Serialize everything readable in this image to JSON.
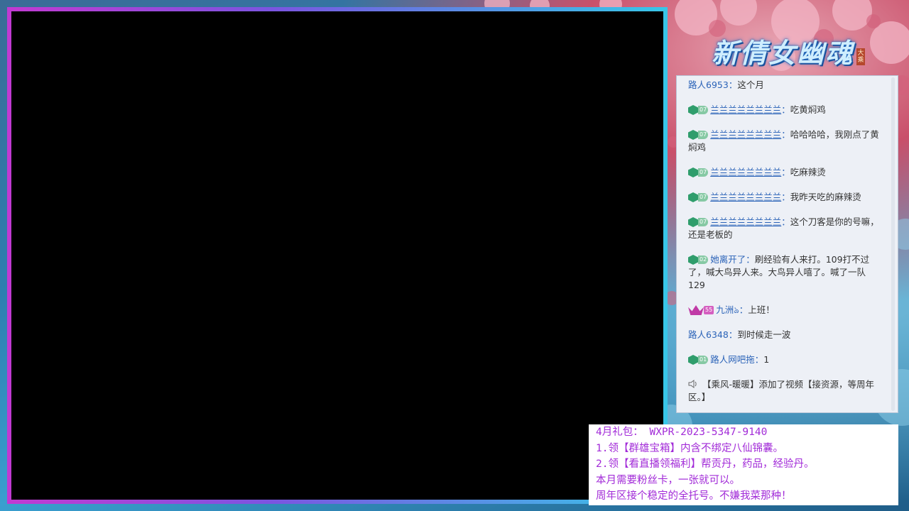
{
  "logo": {
    "text": "新倩女幽魂",
    "tag": "大乘"
  },
  "chat": {
    "messages": [
      {
        "name": "路人6953",
        "sep": "：",
        "text": "这个月",
        "badge": null,
        "underline": false
      },
      {
        "name": "兰兰兰兰兰兰兰兰",
        "sep": "：",
        "text": "吃黄焖鸡",
        "badge": {
          "type": "green",
          "level": "07"
        },
        "underline": true
      },
      {
        "name": "兰兰兰兰兰兰兰兰",
        "sep": "：",
        "text": "哈哈哈哈，我刚点了黄焖鸡",
        "badge": {
          "type": "green",
          "level": "07"
        },
        "underline": true
      },
      {
        "name": "兰兰兰兰兰兰兰兰",
        "sep": "：",
        "text": "吃麻辣烫",
        "badge": {
          "type": "green",
          "level": "07"
        },
        "underline": true
      },
      {
        "name": "兰兰兰兰兰兰兰兰",
        "sep": "：",
        "text": "我昨天吃的麻辣烫",
        "badge": {
          "type": "green",
          "level": "07"
        },
        "underline": true
      },
      {
        "name": "兰兰兰兰兰兰兰兰",
        "sep": "：",
        "text": "这个刀客是你的号嘛，还是老板的",
        "badge": {
          "type": "green",
          "level": "07"
        },
        "underline": true
      },
      {
        "name": "她离开了",
        "sep": "：",
        "text": "刷经验有人来打。109打不过了，喊大鸟异人来。大鸟异人嘻了。喊了一队129",
        "badge": {
          "type": "green",
          "level": "02"
        },
        "underline": false
      },
      {
        "name": "九洲ঌ",
        "sep": "：",
        "text": "上班！",
        "badge": {
          "type": "purple",
          "level": "55"
        },
        "underline": false
      },
      {
        "name": "路人6348",
        "sep": "：",
        "text": "到时候走一波",
        "badge": null,
        "underline": false
      },
      {
        "name": "路人网吧拖",
        "sep": "：",
        "text": "1",
        "badge": {
          "type": "green",
          "level": "01"
        },
        "underline": false
      }
    ],
    "system": {
      "icon": "speaker-icon",
      "text": "【乘风-暖暖】添加了视频【接资源，等周年区。】"
    }
  },
  "notice": {
    "lines": [
      "4月礼包： WXPR-2023-5347-9140",
      "1.领【群雄宝箱】内含不绑定八仙锦囊。",
      "2.领【看直播领福利】帮贡丹，药品，经验丹。",
      "本月需要粉丝卡，一张就可以。",
      "周年区接个稳定的全托号。不嫌我菜那种！"
    ]
  },
  "colors": {
    "notice_text": "#a22bd8",
    "chat_name": "#2b63b8",
    "frame_left": "#c13ad2",
    "frame_right": "#38c6e8"
  }
}
